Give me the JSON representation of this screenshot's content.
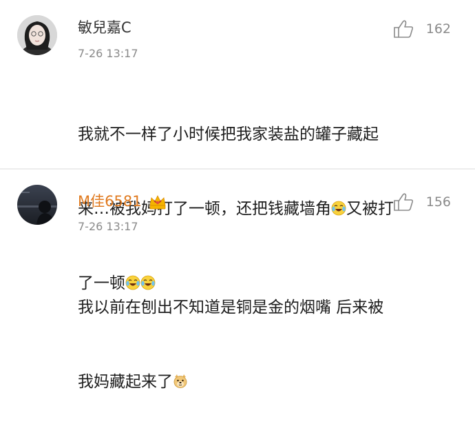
{
  "comments": [
    {
      "username": "敏兒嘉C",
      "time": "7-26 13:17",
      "likes": "162",
      "text": {
        "line1": "我就不一样了小时候把我家装盐的罐子藏起",
        "line2a": "来…被我妈打了一顿，还把钱藏墙角",
        "line2b": "又被打",
        "line3": "了一顿"
      }
    },
    {
      "username": "M佳6581",
      "username_color": "#e07a1f",
      "time": "7-26 13:17",
      "likes": "156",
      "text": {
        "line1": "我以前在刨出不知道是铜是金的烟嘴  后来被",
        "line2": "我妈藏起来了"
      }
    }
  ],
  "icons": {
    "like": "thumbs-up-icon",
    "cry_laugh": "tears-of-joy-emoji",
    "doge": "doge-emoji",
    "vip": "vip-crown-badge"
  }
}
